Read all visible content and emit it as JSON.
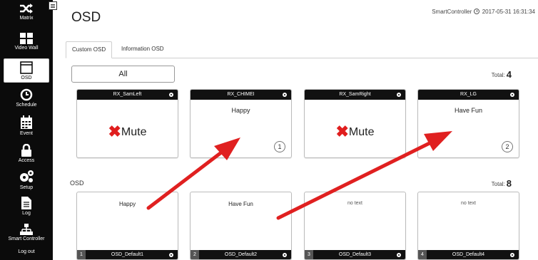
{
  "sidebar": {
    "items": [
      {
        "label": "Matrix",
        "icon": "shuffle-icon"
      },
      {
        "label": "Video Wall",
        "icon": "grid-icon"
      },
      {
        "label": "OSD",
        "icon": "window-icon",
        "active": true
      },
      {
        "label": "Schedule",
        "icon": "clock-icon"
      },
      {
        "label": "Event",
        "icon": "calendar-icon"
      },
      {
        "label": "Access",
        "icon": "lock-icon"
      },
      {
        "label": "Setup",
        "icon": "gears-icon"
      },
      {
        "label": "Log",
        "icon": "document-icon"
      },
      {
        "label": "Smart Controller",
        "icon": "network-icon"
      },
      {
        "label": "Log out",
        "icon": ""
      }
    ]
  },
  "header": {
    "title": "OSD",
    "controller": "SmartController",
    "datetime": "2017-05-31 16:31:34"
  },
  "tabs": [
    {
      "label": "Custom OSD",
      "active": true
    },
    {
      "label": "Information OSD",
      "active": false
    }
  ],
  "filter": {
    "label": "All"
  },
  "receivers": {
    "total_label": "Total:",
    "total": "4",
    "cards": [
      {
        "name": "RX_SamLeft",
        "content": "Mute",
        "type": "mute",
        "badge": ""
      },
      {
        "name": "RX_CHIMEI",
        "content": "Happy",
        "type": "text",
        "badge": "1"
      },
      {
        "name": "RX_SamRight",
        "content": "Mute",
        "type": "mute",
        "badge": ""
      },
      {
        "name": "RX_LG",
        "content": "Have Fun",
        "type": "text",
        "badge": "2"
      }
    ]
  },
  "osd": {
    "section_label": "OSD",
    "total_label": "Total:",
    "total": "8",
    "cards": [
      {
        "num": "1",
        "name": "OSD_Default1",
        "text": "Happy"
      },
      {
        "num": "2",
        "name": "OSD_Default2",
        "text": "Have Fun"
      },
      {
        "num": "3",
        "name": "OSD_Default3",
        "text": "no text"
      },
      {
        "num": "4",
        "name": "OSD_Default4",
        "text": "no text"
      }
    ]
  },
  "colors": {
    "sidebar": "#0b0b0b",
    "arrow": "#e02020",
    "mute_x": "#e01e1e"
  }
}
